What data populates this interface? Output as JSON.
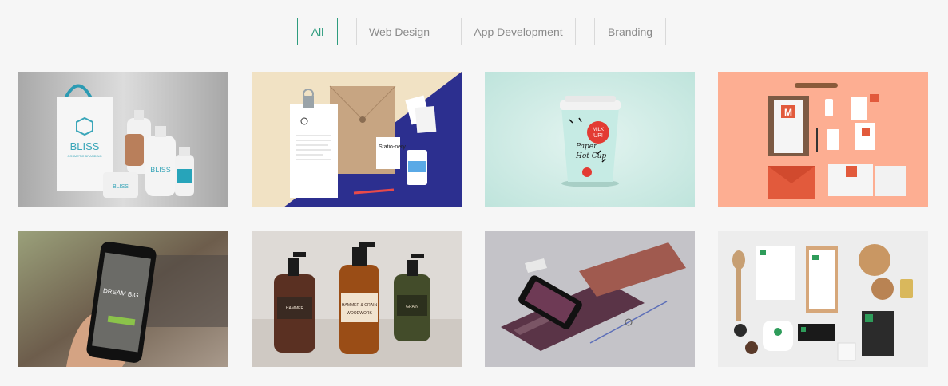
{
  "filters": {
    "all": "All",
    "web_design": "Web Design",
    "app_development": "App Development",
    "branding": "Branding"
  },
  "active_filter": "All",
  "accent_color": "#2e9c7e",
  "portfolio": {
    "items": [
      {
        "brand": "BLISS",
        "subtitle": "COSMETIC BRANDING",
        "bg": "#bdbdbd"
      },
      {
        "label": "Statio-nery",
        "bg": "#2c2f8f"
      },
      {
        "text": [
          "MILK",
          "UP!"
        ],
        "script": [
          "Paper",
          "Hot Cup"
        ],
        "bg": "#c9e9e3"
      },
      {
        "label": "M",
        "bg": "#fdae92"
      },
      {
        "headline": "DREAM BIG",
        "bg": "#7a6a5c"
      },
      {
        "labels": [
          "HAMMER & GRAIN",
          "WOODWORK"
        ],
        "bg": "#d9d5d0"
      },
      {
        "bg": "#bdbcc2"
      },
      {
        "bg": "#eeeeee"
      }
    ]
  }
}
